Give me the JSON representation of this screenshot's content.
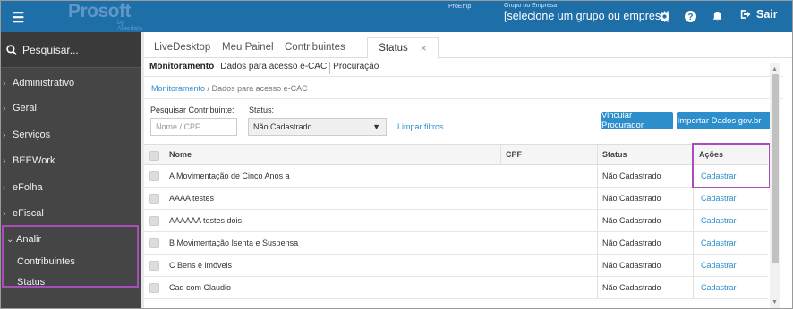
{
  "topbar": {
    "menu_icon": "hamburger-icon",
    "logo_main": "Prosoft",
    "logo_sub": "by Alterdata",
    "proemp": "ProEmp",
    "group_label": "Grupo ou Empresa",
    "group_value": "[selecione um grupo ou empresa]",
    "icons": [
      "gear-icon",
      "help-icon",
      "bell-icon"
    ],
    "logout_label": "Sair",
    "bg_color": "#1e6ea8"
  },
  "sidebar": {
    "search_placeholder": "Pesquisar...",
    "items": [
      {
        "label": "Administrativo"
      },
      {
        "label": "Geral"
      },
      {
        "label": "Serviços"
      },
      {
        "label": "BEEWork"
      },
      {
        "label": "eFolha"
      },
      {
        "label": "eFiscal"
      },
      {
        "label": "Analir"
      }
    ],
    "subitems": [
      {
        "label": "Contribuintes"
      },
      {
        "label": "Status"
      }
    ]
  },
  "tabs": [
    "LiveDesktop",
    "Meu Painel",
    "Contribuintes",
    "Status"
  ],
  "subtabs": [
    "Monitoramento",
    "Dados para acesso e-CAC",
    "Procuração"
  ],
  "breadcrumb": {
    "root": "Monitoramento",
    "sep": "/",
    "current": "Dados para acesso e-CAC"
  },
  "filters": {
    "contrib_label": "Pesquisar Contribuinte:",
    "contrib_placeholder": "Nome / CPF",
    "status_label": "Status:",
    "status_value": "Não Cadastrado",
    "clear_label": "Limpar filtros"
  },
  "buttons": {
    "vincular": "Vincular Procurador",
    "importar": "Importar Dados gov.br"
  },
  "table": {
    "headers": [
      "Nome",
      "CPF",
      "Status",
      "Ações"
    ],
    "rows": [
      {
        "nome": "A Movimentação de Cinco Anos a",
        "cpf": "",
        "status": "Não Cadastrado",
        "acao": "Cadastrar"
      },
      {
        "nome": "AAAA testes",
        "cpf": "",
        "status": "Não Cadastrado",
        "acao": "Cadastrar"
      },
      {
        "nome": "AAAAAA testes dois",
        "cpf": "",
        "status": "Não Cadastrado",
        "acao": "Cadastrar"
      },
      {
        "nome": "B Movimentação Isenta e Suspensa",
        "cpf": "",
        "status": "Não Cadastrado",
        "acao": "Cadastrar"
      },
      {
        "nome": "C Bens e imóveis",
        "cpf": "",
        "status": "Não Cadastrado",
        "acao": "Cadastrar"
      },
      {
        "nome": "Cad com Claudio",
        "cpf": "",
        "status": "Não Cadastrado",
        "acao": "Cadastrar"
      }
    ]
  },
  "colors": {
    "accent": "#2d8ecc",
    "highlight": "#a94dbb",
    "sidebar": "#454545"
  }
}
